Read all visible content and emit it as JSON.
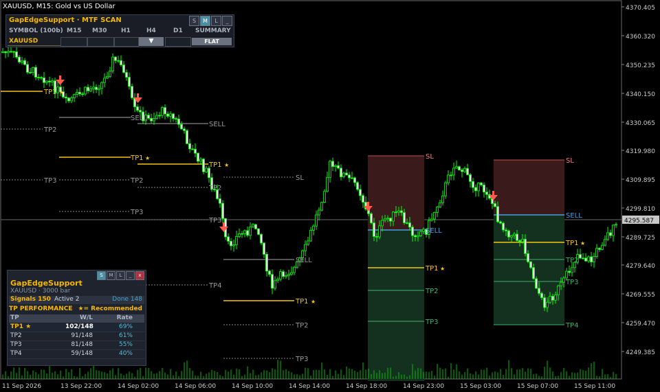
{
  "window": {
    "title": "XAUUSD, M15:  Gold vs US Dollar"
  },
  "colors": {
    "bull": "#00ff00",
    "bear": "#00ff00",
    "grid": "#555555",
    "tp1": "#f5c518",
    "tpdim": "#9a9a9a",
    "sl": "#f08080",
    "sell": "#4a9fe0",
    "accent": "#f5b800",
    "tp_green": "#3cb371"
  },
  "price_axis": {
    "labels": [
      "4370.405",
      "4360.320",
      "4350.235",
      "4340.150",
      "4330.065",
      "4319.980",
      "4309.895",
      "4299.810",
      "4289.725",
      "4279.640",
      "4269.555",
      "4259.470",
      "4249.385"
    ],
    "current_price": "4295.587"
  },
  "time_axis": {
    "labels": [
      "11 Sep 2026",
      "13 Sep 22:00",
      "14 Sep 02:00",
      "14 Sep 06:00",
      "14 Sep 10:00",
      "14 Sep 14:00",
      "14 Sep 18:00",
      "14 Sep 23:00",
      "15 Sep 03:00",
      "15 Sep 07:00",
      "15 Sep 11:00"
    ]
  },
  "chart_labels": {
    "tp1": "TP1",
    "tp2": "TP2",
    "tp3": "TP3",
    "tp4": "TP4",
    "sl": "SL",
    "sell": "SELL",
    "star": "★"
  },
  "mtf_panel": {
    "title": "GapEdgeSupport · MTF SCAN",
    "controls": [
      "S",
      "M",
      "L",
      "_"
    ],
    "headers": [
      "SYMBOL (100b)",
      "M15",
      "M30",
      "H1",
      "H4",
      "D1",
      "SUMMARY"
    ],
    "symbol": "XAUUSD",
    "h4_signal": "▼",
    "summary": "FLAT"
  },
  "perf_panel": {
    "controls": [
      "S",
      "M",
      "L",
      "_",
      "x"
    ],
    "name": "GapEdgeSupport",
    "subtitle": "XAUUSD · 3000 bar",
    "signals": "Signals 150",
    "active": "Active 2",
    "done": "Done 148",
    "tp_title": "TP PERFORMANCE",
    "recommended": "★= Recommended",
    "columns": [
      "TP",
      "W/L",
      "Rate"
    ],
    "rows": [
      {
        "tp": "TP1 ★",
        "wl": "102/148",
        "rate": "69%"
      },
      {
        "tp": "TP2",
        "wl": "91/148",
        "rate": "61%"
      },
      {
        "tp": "TP3",
        "wl": "81/148",
        "rate": "55%"
      },
      {
        "tp": "TP4",
        "wl": "59/148",
        "rate": "40%"
      }
    ]
  }
}
